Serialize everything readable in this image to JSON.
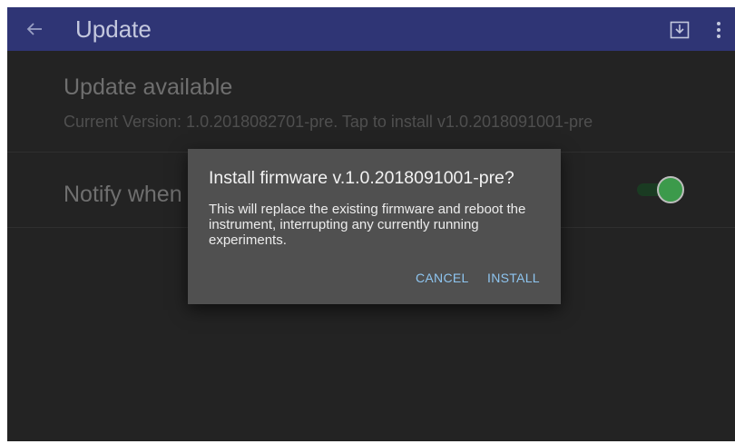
{
  "appbar": {
    "title": "Update",
    "back_icon": "arrow-left-icon",
    "download_icon": "download-tray-icon",
    "more_icon": "more-vert-icon",
    "color": "#2f3575"
  },
  "preferences": {
    "update": {
      "title": "Update available",
      "summary": "Current Version: 1.0.2018082701-pre. Tap to install v1.0.2018091001-pre"
    },
    "notify": {
      "title": "Notify when",
      "switch_on": true,
      "switch_color": "#3c9a4b"
    }
  },
  "dialog": {
    "title": "Install firmware v.1.0.2018091001-pre?",
    "message": "This will replace the existing firmware and reboot the instrument, interrupting any currently running experiments.",
    "cancel_label": "CANCEL",
    "install_label": "INSTALL",
    "accent": "#8ec5f0"
  }
}
